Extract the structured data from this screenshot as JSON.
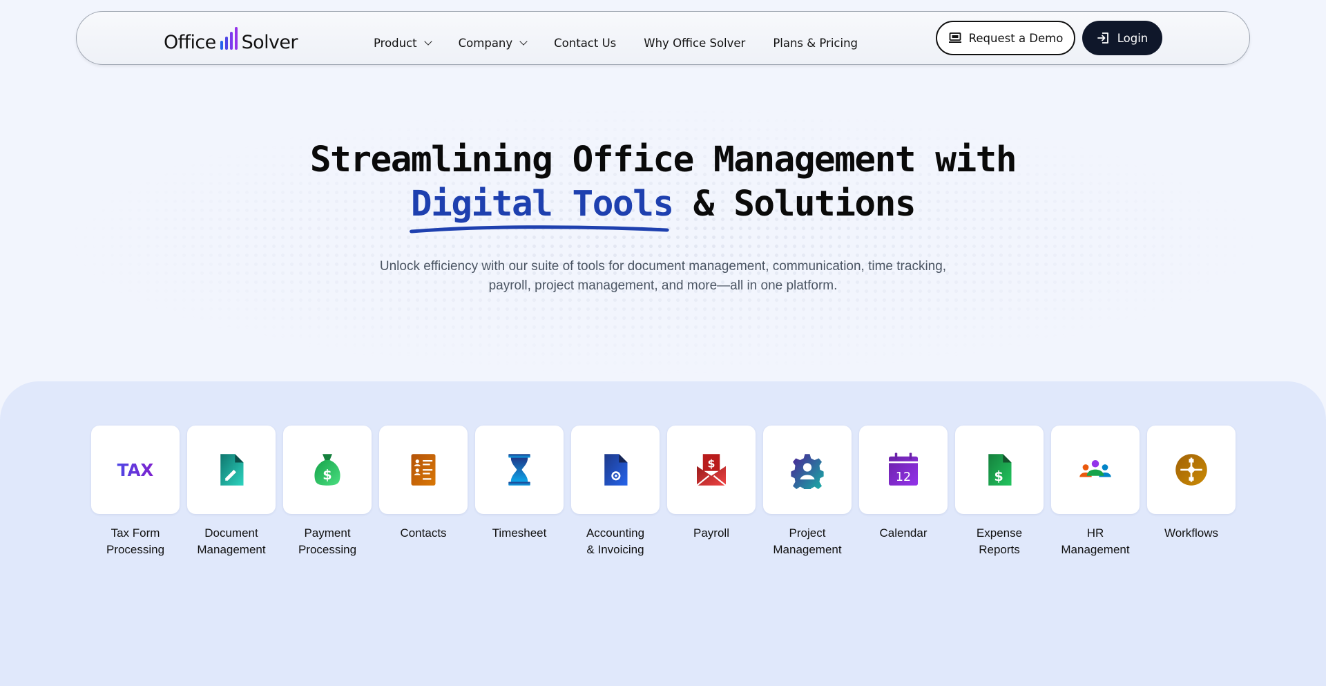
{
  "brand": {
    "word1": "Office",
    "word2": "Solver",
    "bar_colors": [
      "#2563eb",
      "#4f46e5",
      "#7c3aed",
      "#9333ea"
    ]
  },
  "nav": {
    "items": [
      {
        "label": "Product",
        "has_dropdown": true
      },
      {
        "label": "Company",
        "has_dropdown": true
      },
      {
        "label": "Contact Us",
        "has_dropdown": false
      },
      {
        "label": "Why Office Solver",
        "has_dropdown": false
      },
      {
        "label": "Plans & Pricing",
        "has_dropdown": false
      }
    ],
    "demo_label": "Request a Demo",
    "demo_icon": "monitor-icon",
    "login_label": "Login",
    "login_icon": "login-icon"
  },
  "hero": {
    "title_line1": "Streamlining Office Management with",
    "title_highlight": "Digital Tools",
    "title_rest": " & Solutions",
    "highlight_color": "#1e40af",
    "subtitle": "Unlock efficiency with our suite of tools for document management, communication, time tracking, payroll, project management, and more—all in one platform."
  },
  "tools": [
    {
      "line1": "Tax Form",
      "line2": "Processing",
      "icon": "tax-icon",
      "tile_text": "TAX"
    },
    {
      "line1": "Document",
      "line2": "Management",
      "icon": "document-edit-icon"
    },
    {
      "line1": "Payment",
      "line2": "Processing",
      "icon": "money-bag-icon"
    },
    {
      "line1": "Contacts",
      "line2": "",
      "icon": "contacts-list-icon"
    },
    {
      "line1": "Timesheet",
      "line2": "",
      "icon": "hourglass-icon"
    },
    {
      "line1": "Accounting",
      "line2": "& Invoicing",
      "icon": "invoice-gear-icon"
    },
    {
      "line1": "Payroll",
      "line2": "",
      "icon": "payroll-envelope-icon"
    },
    {
      "line1": "Project",
      "line2": "Management",
      "icon": "project-gear-icon"
    },
    {
      "line1": "Calendar",
      "line2": "",
      "icon": "calendar-icon",
      "tile_text": "12"
    },
    {
      "line1": "Expense",
      "line2": "Reports",
      "icon": "expense-report-icon"
    },
    {
      "line1": "HR",
      "line2": "Management",
      "icon": "team-people-icon"
    },
    {
      "line1": "Workflows",
      "line2": "",
      "icon": "workflow-icon"
    }
  ]
}
